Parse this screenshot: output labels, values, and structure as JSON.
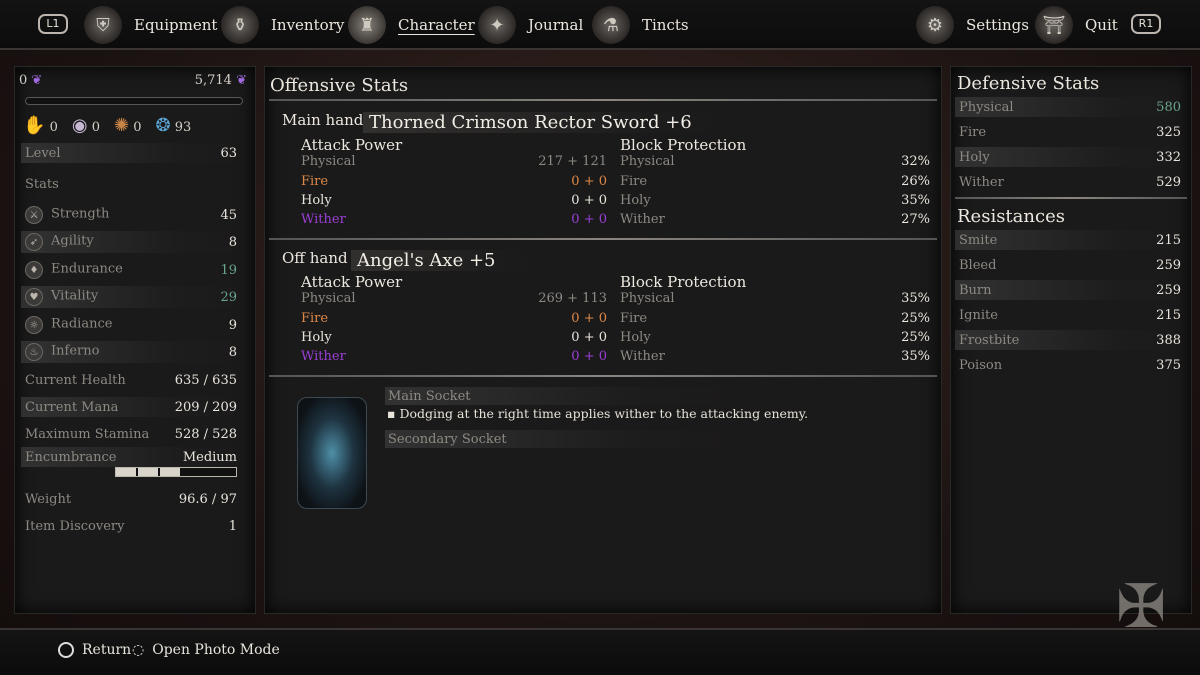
{
  "top_nav": {
    "left_button": "L1",
    "right_button": "R1",
    "tabs": [
      {
        "label": "Equipment",
        "icon": "shield-icon"
      },
      {
        "label": "Inventory",
        "icon": "satchel-icon"
      },
      {
        "label": "Character",
        "icon": "character-icon",
        "active": true
      },
      {
        "label": "Journal",
        "icon": "star-icon"
      },
      {
        "label": "Tincts",
        "icon": "flask-icon"
      }
    ],
    "settings": "Settings",
    "quit": "Quit"
  },
  "left_panel": {
    "currency_left": "0",
    "currency_right": "5,714",
    "consumables": [
      {
        "icon": "hand-icon",
        "count": "0"
      },
      {
        "icon": "orb-icon",
        "count": "0"
      },
      {
        "icon": "rock-icon",
        "count": "0"
      },
      {
        "icon": "crystal-icon",
        "count": "93"
      }
    ],
    "level_label": "Level",
    "level_value": "63",
    "stats_heading": "Stats",
    "attributes": [
      {
        "name": "Strength",
        "value": "45",
        "color": "#e8e4dc"
      },
      {
        "name": "Agility",
        "value": "8",
        "color": "#e8e4dc"
      },
      {
        "name": "Endurance",
        "value": "19",
        "color": "#69a58c"
      },
      {
        "name": "Vitality",
        "value": "29",
        "color": "#69a58c"
      },
      {
        "name": "Radiance",
        "value": "9",
        "color": "#e8e4dc"
      },
      {
        "name": "Inferno",
        "value": "8",
        "color": "#e8e4dc"
      }
    ],
    "vitals": [
      {
        "name": "Current Health",
        "value": "635 / 635"
      },
      {
        "name": "Current Mana",
        "value": "209 / 209"
      },
      {
        "name": "Maximum Stamina",
        "value": "528 / 528"
      }
    ],
    "encumbrance_label": "Encumbrance",
    "encumbrance_value": "Medium",
    "encumbrance_fill": 0.55,
    "weight_label": "Weight",
    "weight_value": "96.6 / 97",
    "discovery_label": "Item Discovery",
    "discovery_value": "1"
  },
  "offensive": {
    "title": "Offensive Stats",
    "main": {
      "slot": "Main hand",
      "weapon": "Thorned Crimson Rector Sword +6",
      "attack_heading": "Attack Power",
      "block_heading": "Block Protection",
      "attack": [
        {
          "name": "Physical",
          "value": "217 + 121"
        },
        {
          "name": "Fire",
          "value": "0 + 0"
        },
        {
          "name": "Holy",
          "value": "0 + 0"
        },
        {
          "name": "Wither",
          "value": "0 + 0"
        }
      ],
      "block": [
        {
          "name": "Physical",
          "value": "32%"
        },
        {
          "name": "Fire",
          "value": "26%"
        },
        {
          "name": "Holy",
          "value": "35%"
        },
        {
          "name": "Wither",
          "value": "27%"
        }
      ]
    },
    "off": {
      "slot": "Off hand",
      "weapon": "Angel's Axe +5",
      "attack_heading": "Attack Power",
      "block_heading": "Block Protection",
      "attack": [
        {
          "name": "Physical",
          "value": "269 + 113"
        },
        {
          "name": "Fire",
          "value": "0 + 0"
        },
        {
          "name": "Holy",
          "value": "0 + 0"
        },
        {
          "name": "Wither",
          "value": "0 + 0"
        }
      ],
      "block": [
        {
          "name": "Physical",
          "value": "35%"
        },
        {
          "name": "Fire",
          "value": "25%"
        },
        {
          "name": "Holy",
          "value": "25%"
        },
        {
          "name": "Wither",
          "value": "35%"
        }
      ]
    },
    "socket": {
      "main_label": "Main Socket",
      "main_effect": "▪ Dodging at the right time applies wither to the attacking enemy.",
      "secondary_label": "Secondary Socket"
    }
  },
  "defensive": {
    "title": "Defensive Stats",
    "stats": [
      {
        "name": "Physical",
        "value": "580",
        "color": "#69a58c"
      },
      {
        "name": "Fire",
        "value": "325",
        "color": "#e8e4dc"
      },
      {
        "name": "Holy",
        "value": "332",
        "color": "#e8e4dc"
      },
      {
        "name": "Wither",
        "value": "529",
        "color": "#e8e4dc"
      }
    ],
    "resist_title": "Resistances",
    "resistances": [
      {
        "name": "Smite",
        "value": "215"
      },
      {
        "name": "Bleed",
        "value": "259"
      },
      {
        "name": "Burn",
        "value": "259"
      },
      {
        "name": "Ignite",
        "value": "215"
      },
      {
        "name": "Frostbite",
        "value": "388"
      },
      {
        "name": "Poison",
        "value": "375"
      }
    ]
  },
  "footer": {
    "return": "Return",
    "photo": "Open Photo Mode"
  }
}
